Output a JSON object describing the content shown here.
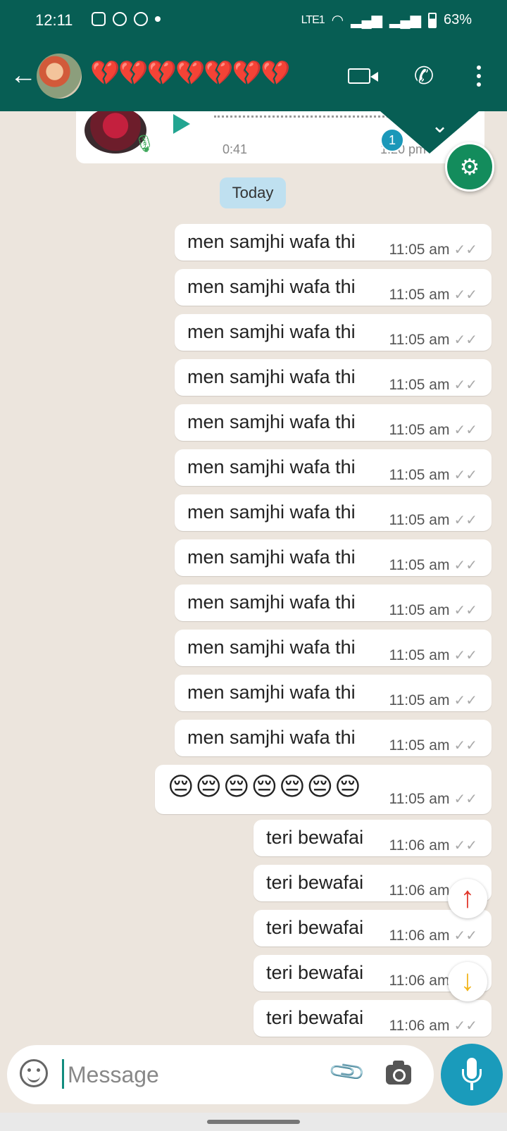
{
  "status_bar": {
    "time": "12:11",
    "network": "LTE1",
    "battery": "63%"
  },
  "header": {
    "contact_name": "💔💔💔💔💔💔💔",
    "back_icon": "arrow-left-icon",
    "video_icon": "video-camera-icon",
    "call_icon": "phone-icon",
    "menu_icon": "more-vertical-icon"
  },
  "voice_message": {
    "duration": "0:41",
    "time": "1:20 pm"
  },
  "unread_badge": "1",
  "date_divider": "Today",
  "messages": [
    {
      "text": "men samjhi wafa thi",
      "time": "11:05 am"
    },
    {
      "text": "men samjhi wafa thi",
      "time": "11:05 am"
    },
    {
      "text": "men samjhi wafa thi",
      "time": "11:05 am"
    },
    {
      "text": "men samjhi wafa thi",
      "time": "11:05 am"
    },
    {
      "text": "men samjhi wafa thi",
      "time": "11:05 am"
    },
    {
      "text": "men samjhi wafa thi",
      "time": "11:05 am"
    },
    {
      "text": "men samjhi wafa thi",
      "time": "11:05 am"
    },
    {
      "text": "men samjhi wafa thi",
      "time": "11:05 am"
    },
    {
      "text": "men samjhi wafa thi",
      "time": "11:05 am"
    },
    {
      "text": "men samjhi wafa thi",
      "time": "11:05 am"
    },
    {
      "text": "men samjhi wafa thi",
      "time": "11:05 am"
    },
    {
      "text": "men samjhi wafa thi",
      "time": "11:05 am"
    },
    {
      "text": "😔😔😔😔😔😔😔",
      "time": "11:05 am"
    },
    {
      "text": "teri bewafai",
      "time": "11:06 am"
    },
    {
      "text": "teri bewafai",
      "time": "11:06 am"
    },
    {
      "text": "teri bewafai",
      "time": "11:06 am"
    },
    {
      "text": "teri bewafai",
      "time": "11:06 am"
    },
    {
      "text": "teri bewafai",
      "time": "11:06 am"
    }
  ],
  "input": {
    "placeholder": "Message"
  },
  "colors": {
    "header": "#075e54",
    "chat_bg": "#ece5dd",
    "accent": "#1a9bbb",
    "broken_heart": "#e01b3c"
  }
}
